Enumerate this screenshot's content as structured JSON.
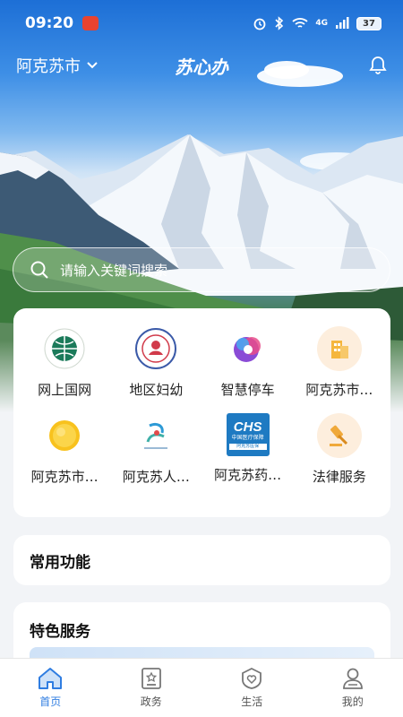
{
  "status_bar": {
    "time": "09:20",
    "network": "4G",
    "battery": "37"
  },
  "header": {
    "city": "阿克苏市",
    "title": "苏心办"
  },
  "search": {
    "placeholder": "请输入关键词搜索"
  },
  "services": [
    {
      "label": "网上国网",
      "icon": "state-grid-logo-icon"
    },
    {
      "label": "地区妇幼",
      "icon": "maternal-child-logo-icon"
    },
    {
      "label": "智慧停车",
      "icon": "smart-parking-logo-icon"
    },
    {
      "label": "阿克苏市…",
      "icon": "building-icon"
    },
    {
      "label": "阿克苏市…",
      "icon": "sun-icon"
    },
    {
      "label": "阿克苏人…",
      "icon": "hospital-logo-icon"
    },
    {
      "label": "阿克苏药…",
      "icon": "chs-medical-insurance-logo-icon"
    },
    {
      "label": "法律服务",
      "icon": "gavel-icon"
    }
  ],
  "chs_logo": {
    "text": "CHS",
    "subtitle": "中国医疗保障",
    "region": "阿克苏医保"
  },
  "sections": {
    "common": "常用功能",
    "featured": "特色服务"
  },
  "bottom_nav": [
    {
      "label": "首页",
      "icon": "home-icon",
      "active": true
    },
    {
      "label": "政务",
      "icon": "government-affairs-icon",
      "active": false
    },
    {
      "label": "生活",
      "icon": "life-heart-icon",
      "active": false
    },
    {
      "label": "我的",
      "icon": "profile-icon",
      "active": false
    }
  ],
  "colors": {
    "accent": "#2f7de1",
    "sky": "#3e8fe6"
  }
}
